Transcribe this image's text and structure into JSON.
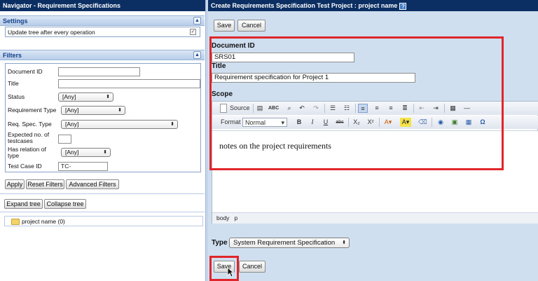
{
  "navigator": {
    "title": "Navigator - Requirement Specifications",
    "settings": {
      "header": "Settings",
      "update_tree_label": "Update tree after every operation",
      "update_tree_checked": true
    },
    "filters": {
      "header": "Filters",
      "document_id_label": "Document ID",
      "document_id_value": "",
      "title_label": "Title",
      "title_value": "",
      "status_label": "Status",
      "status_value": "[Any]",
      "requirement_type_label": "Requirement Type",
      "requirement_type_value": "[Any]",
      "req_spec_type_label": "Req. Spec. Type",
      "req_spec_type_value": "[Any]",
      "expected_testcases_label": "Expected no. of testcases",
      "expected_testcases_value": "",
      "has_relation_label": "Has relation of type",
      "has_relation_value": "[Any]",
      "test_case_id_label": "Test Case ID",
      "test_case_id_value": "TC-"
    },
    "buttons": {
      "apply": "Apply",
      "reset_filters": "Reset Filters",
      "advanced_filters": "Advanced Filters",
      "expand_tree": "Expand tree",
      "collapse_tree": "Collapse tree"
    },
    "tree": {
      "root_label": "project name (0)"
    }
  },
  "form": {
    "title": "Create Requirements Specification Test Project : project name",
    "help_icon_text": "?",
    "save_label": "Save",
    "cancel_label": "Cancel",
    "document_id_label": "Document ID",
    "document_id_value": "SRS01",
    "title_label": "Title",
    "title_value": "Requirement specification for Project 1",
    "scope_label": "Scope",
    "toolbar": {
      "source_label": "Source",
      "format_label": "Format",
      "format_value": "Normal",
      "bold": "B",
      "italic": "I",
      "underline": "U",
      "strike": "abc",
      "subscript": "X₂",
      "superscript": "X²",
      "omega": "Ω"
    },
    "scope_text": "notes on the project requirements",
    "path_body": "body",
    "path_p": "p",
    "type_label": "Type",
    "type_value": "System Requirement Specification",
    "highlight_color": "#e0262b"
  }
}
